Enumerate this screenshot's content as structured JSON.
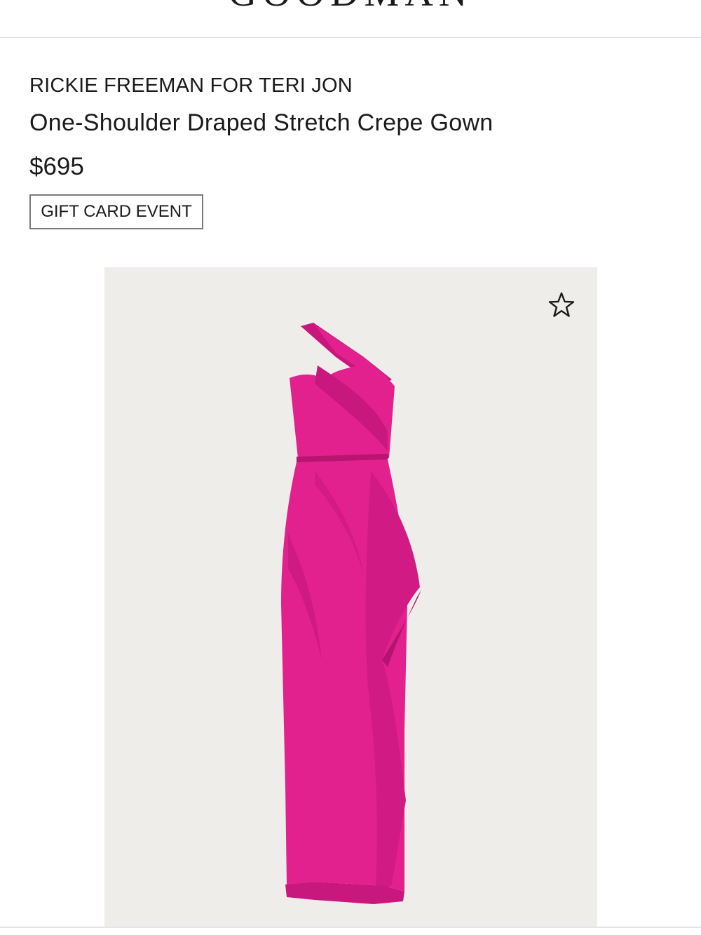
{
  "header": {
    "logo_text": "GOODMAN"
  },
  "product": {
    "brand": "RICKIE FREEMAN FOR TERI JON",
    "name": "One-Shoulder Draped Stretch Crepe Gown",
    "price": "$695",
    "promo_badge": "GIFT CARD EVENT",
    "image": {
      "alt": "Pink one-shoulder draped gown",
      "background_color": "#efede9",
      "garment_color": "#e2218f"
    },
    "favorite_icon": "star-outline-icon"
  }
}
